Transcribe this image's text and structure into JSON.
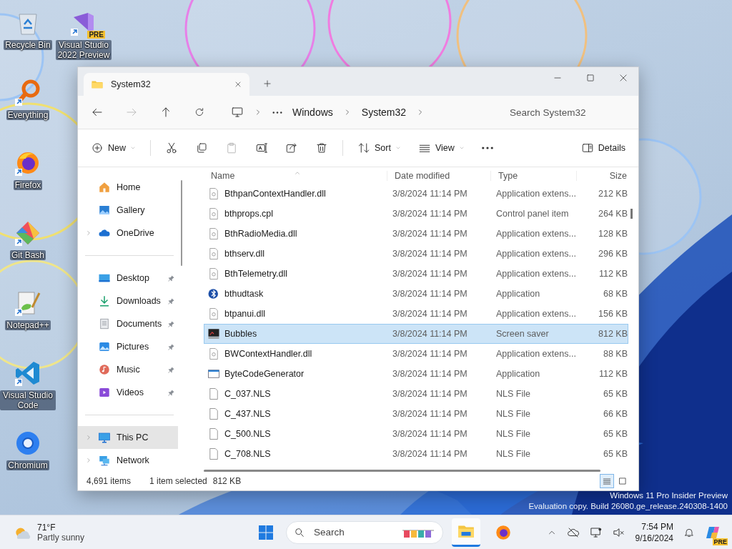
{
  "desktop_icons": [
    {
      "label": "Recycle Bin",
      "kind": "recycle",
      "shortcut": false
    },
    {
      "label": "Visual Studio 2022 Preview",
      "kind": "vs",
      "shortcut": true,
      "badge": "PRE"
    },
    {
      "label": "Everything",
      "kind": "everything",
      "shortcut": true
    },
    {
      "label": "Firefox",
      "kind": "firefox",
      "shortcut": true
    },
    {
      "label": "Git Bash",
      "kind": "git",
      "shortcut": true
    },
    {
      "label": "Notepad++",
      "kind": "notepad",
      "shortcut": true
    },
    {
      "label": "Visual Studio Code",
      "kind": "vscode",
      "shortcut": true
    },
    {
      "label": "Chromium",
      "kind": "chromium",
      "shortcut": false
    }
  ],
  "window": {
    "tab": {
      "title": "System32"
    },
    "address": {
      "breadcrumbs": [
        "Windows",
        "System32"
      ]
    },
    "search": {
      "placeholder": "Search System32"
    },
    "toolbar": [
      {
        "kind": "new",
        "label": "New",
        "disabled": false
      },
      {
        "kind": "separator"
      },
      {
        "kind": "cut",
        "disabled": false
      },
      {
        "kind": "copy",
        "disabled": false
      },
      {
        "kind": "paste",
        "disabled": true
      },
      {
        "kind": "rename",
        "disabled": false
      },
      {
        "kind": "share",
        "disabled": false
      },
      {
        "kind": "delete",
        "disabled": false
      },
      {
        "kind": "separator"
      },
      {
        "kind": "sort",
        "label": "Sort",
        "disabled": false
      },
      {
        "kind": "view",
        "label": "View",
        "disabled": false
      },
      {
        "kind": "more",
        "disabled": false
      },
      {
        "kind": "spacer"
      },
      {
        "kind": "details",
        "label": "Details",
        "disabled": false
      }
    ],
    "sidebar": {
      "groups": [
        {
          "items": [
            {
              "label": "Home",
              "kind": "home",
              "expandable": false,
              "pinned": false,
              "selected": false
            },
            {
              "label": "Gallery",
              "kind": "gallery",
              "expandable": false,
              "pinned": false,
              "selected": false
            },
            {
              "label": "OneDrive",
              "kind": "onedrive",
              "expandable": true,
              "pinned": false,
              "selected": false
            }
          ]
        },
        {
          "items": [
            {
              "label": "Desktop",
              "kind": "desktop",
              "expandable": false,
              "pinned": true,
              "selected": false
            },
            {
              "label": "Downloads",
              "kind": "downloads",
              "expandable": false,
              "pinned": true,
              "selected": false
            },
            {
              "label": "Documents",
              "kind": "documents",
              "expandable": false,
              "pinned": true,
              "selected": false
            },
            {
              "label": "Pictures",
              "kind": "pictures",
              "expandable": false,
              "pinned": true,
              "selected": false
            },
            {
              "label": "Music",
              "kind": "music",
              "expandable": false,
              "pinned": true,
              "selected": false
            },
            {
              "label": "Videos",
              "kind": "videos",
              "expandable": false,
              "pinned": true,
              "selected": false
            }
          ]
        },
        {
          "items": [
            {
              "label": "This PC",
              "kind": "pc",
              "expandable": true,
              "pinned": false,
              "selected": true
            },
            {
              "label": "Network",
              "kind": "network",
              "expandable": true,
              "pinned": false,
              "selected": false
            }
          ]
        }
      ]
    },
    "table": {
      "columns": [
        "Name",
        "Date modified",
        "Type",
        "Size"
      ],
      "rows": [
        {
          "name": "BthpanContextHandler.dll",
          "date": "3/8/2024 11:14 PM",
          "type": "Application extens...",
          "size": "212 KB",
          "kind": "dll",
          "selected": false
        },
        {
          "name": "bthprops.cpl",
          "date": "3/8/2024 11:14 PM",
          "type": "Control panel item",
          "size": "264 KB",
          "kind": "dll",
          "selected": false
        },
        {
          "name": "BthRadioMedia.dll",
          "date": "3/8/2024 11:14 PM",
          "type": "Application extens...",
          "size": "128 KB",
          "kind": "dll",
          "selected": false
        },
        {
          "name": "bthserv.dll",
          "date": "3/8/2024 11:14 PM",
          "type": "Application extens...",
          "size": "296 KB",
          "kind": "dll",
          "selected": false
        },
        {
          "name": "BthTelemetry.dll",
          "date": "3/8/2024 11:14 PM",
          "type": "Application extens...",
          "size": "112 KB",
          "kind": "dll",
          "selected": false
        },
        {
          "name": "bthudtask",
          "date": "3/8/2024 11:14 PM",
          "type": "Application",
          "size": "68 KB",
          "kind": "bluetooth",
          "selected": false
        },
        {
          "name": "btpanui.dll",
          "date": "3/8/2024 11:14 PM",
          "type": "Application extens...",
          "size": "156 KB",
          "kind": "dll",
          "selected": false
        },
        {
          "name": "Bubbles",
          "date": "3/8/2024 11:14 PM",
          "type": "Screen saver",
          "size": "812 KB",
          "kind": "screensaver",
          "selected": true
        },
        {
          "name": "BWContextHandler.dll",
          "date": "3/8/2024 11:14 PM",
          "type": "Application extens...",
          "size": "88 KB",
          "kind": "dll",
          "selected": false
        },
        {
          "name": "ByteCodeGenerator",
          "date": "3/8/2024 11:14 PM",
          "type": "Application",
          "size": "112 KB",
          "kind": "app",
          "selected": false
        },
        {
          "name": "C_037.NLS",
          "date": "3/8/2024 11:14 PM",
          "type": "NLS File",
          "size": "65 KB",
          "kind": "file",
          "selected": false
        },
        {
          "name": "C_437.NLS",
          "date": "3/8/2024 11:14 PM",
          "type": "NLS File",
          "size": "66 KB",
          "kind": "file",
          "selected": false
        },
        {
          "name": "C_500.NLS",
          "date": "3/8/2024 11:14 PM",
          "type": "NLS File",
          "size": "65 KB",
          "kind": "file",
          "selected": false
        },
        {
          "name": "C_708.NLS",
          "date": "3/8/2024 11:14 PM",
          "type": "NLS File",
          "size": "65 KB",
          "kind": "file",
          "selected": false
        }
      ]
    },
    "status_bar": {
      "item_count": "4,691 items",
      "selection": "1 item selected",
      "selection_size": "812 KB",
      "view_buttons": [
        {
          "kind": "details",
          "selected": true
        },
        {
          "kind": "tiles",
          "selected": false
        }
      ]
    }
  },
  "watermark": {
    "edition": "Windows 11 Pro Insider Preview",
    "build": "Evaluation copy. Build 26080.ge_release.240308-1400"
  },
  "taskbar": {
    "weather": {
      "temperature": "71°F",
      "condition": "Partly sunny"
    },
    "search": {
      "placeholder": "Search"
    },
    "apps": [
      {
        "kind": "explorer",
        "selected": true
      },
      {
        "kind": "firefox",
        "selected": false
      }
    ],
    "tray": {
      "time": "7:54 PM",
      "date": "9/16/2024",
      "copilot_badge": "PRE"
    }
  }
}
